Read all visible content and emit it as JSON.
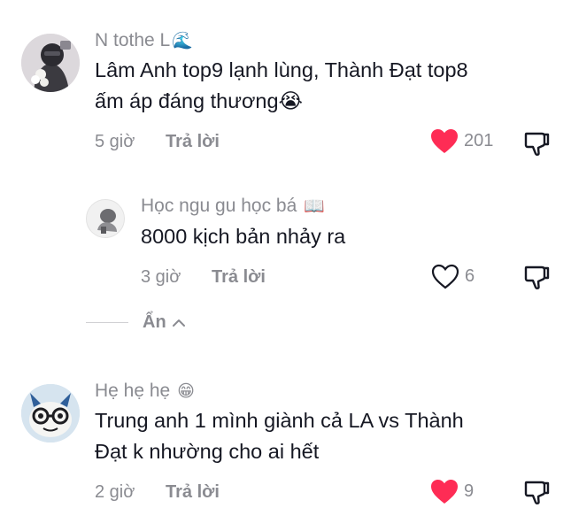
{
  "comments": [
    {
      "author": "N tothe L",
      "author_emoji": "🌊",
      "text_lines": [
        "Lâm Anh top9 lạnh lùng, Thành Đạt top8",
        "ấm áp đáng thương😭"
      ],
      "time": "5 giờ",
      "reply_label": "Trả lời",
      "likes": "201",
      "liked": true
    },
    {
      "author": "Học ngu gu học bá",
      "author_emoji": "📖",
      "text_lines": [
        "8000 kịch bản nhảy ra"
      ],
      "time": "3 giờ",
      "reply_label": "Trả lời",
      "likes": "6",
      "liked": false
    },
    {
      "author": "Hẹ hẹ hẹ",
      "author_emoji": "😁",
      "text_lines": [
        "Trung anh 1 mình giành cả LA vs Thành",
        "Đạt k nhường cho ai hết"
      ],
      "time": "2 giờ",
      "reply_label": "Trả lời",
      "likes": "9",
      "liked": true
    }
  ],
  "hide_replies_label": "Ẩn",
  "colors": {
    "liked": "#fe2c55",
    "muted": "#8a8b91",
    "text": "#161823"
  },
  "icons": [
    "heart-filled-icon",
    "heart-outline-icon",
    "dislike-icon",
    "chevron-up-icon"
  ]
}
